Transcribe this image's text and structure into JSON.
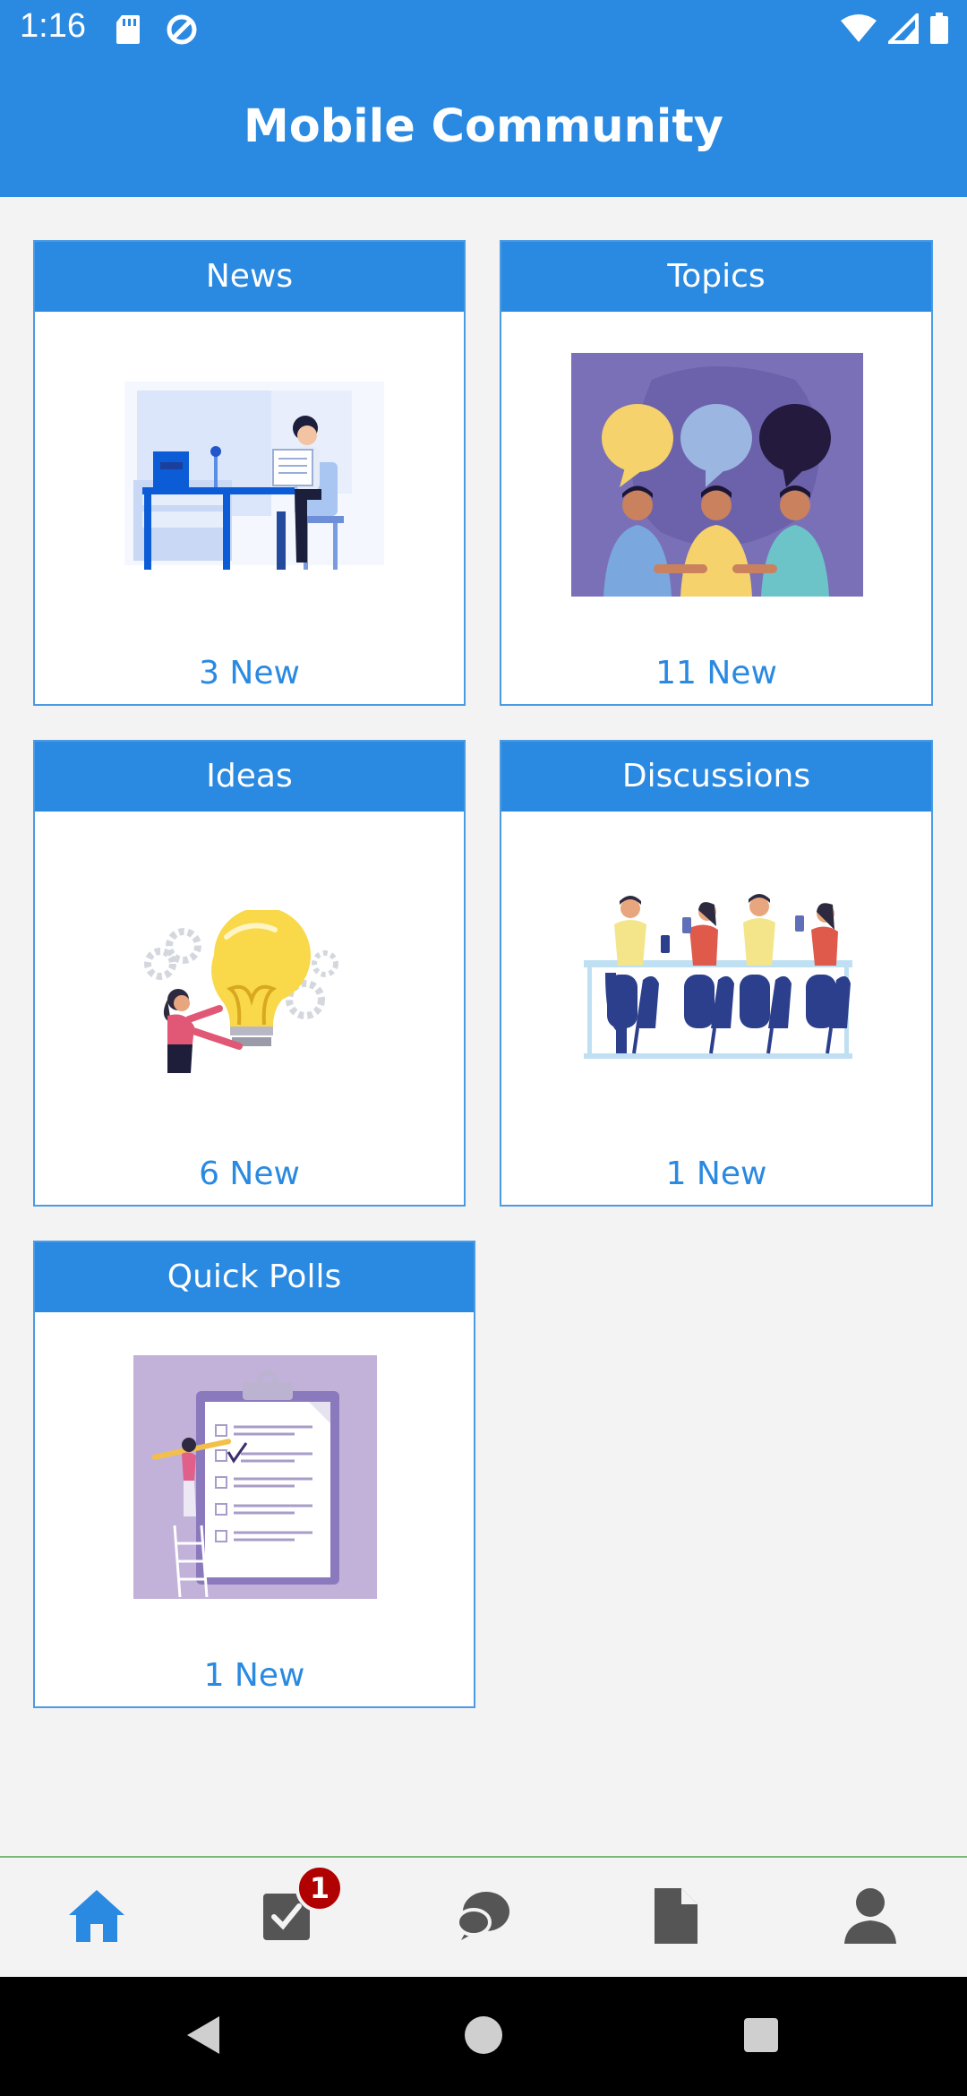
{
  "status": {
    "time": "1:16"
  },
  "app": {
    "title": "Mobile Community"
  },
  "cards": {
    "news": {
      "title": "News",
      "count": "3 New"
    },
    "topics": {
      "title": "Topics",
      "count": "11 New"
    },
    "ideas": {
      "title": "Ideas",
      "count": "6 New"
    },
    "discussions": {
      "title": "Discussions",
      "count": "1 New"
    },
    "polls": {
      "title": "Quick Polls",
      "count": "1 New"
    }
  },
  "nav": {
    "items": [
      "home-icon",
      "tasks-icon",
      "chat-icon",
      "document-icon",
      "profile-icon"
    ],
    "badge": "1"
  },
  "colors": {
    "primary": "#2a89e0",
    "badge": "#b00000",
    "inactive_icon": "#555555"
  }
}
